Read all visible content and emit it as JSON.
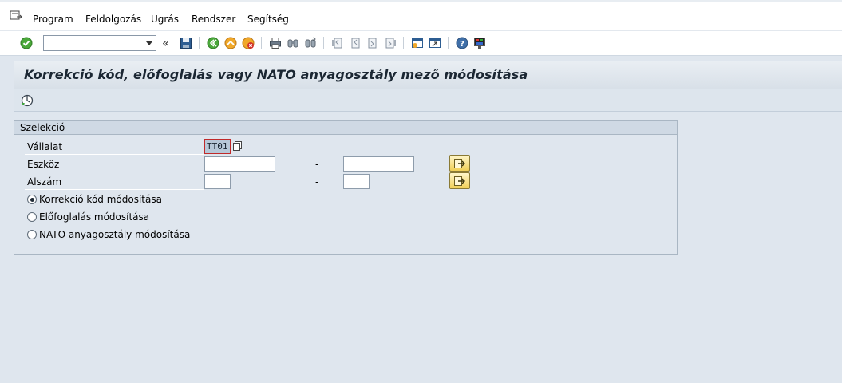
{
  "menu": {
    "items": [
      {
        "label": "Program"
      },
      {
        "label": "Feldolgozás"
      },
      {
        "label": "Ugrás"
      },
      {
        "label": "Rendszer"
      },
      {
        "label": "Segítség"
      }
    ]
  },
  "toolbar": {
    "command_value": "",
    "icons": [
      "enter-icon",
      "save-icon",
      "back-icon",
      "exit-icon",
      "cancel-icon",
      "print-icon",
      "find-icon",
      "find-next-icon",
      "first-page-icon",
      "previous-page-icon",
      "next-page-icon",
      "last-page-icon",
      "create-session-icon",
      "shortcut-icon",
      "help-icon",
      "customize-layout-icon"
    ]
  },
  "title": "Korrekció kód, előfoglalás vagy NATO anyagosztály mező módosítása",
  "group": {
    "title": "Szelekció",
    "fields": {
      "company": {
        "label": "Vállalat",
        "value": "TT01"
      },
      "asset": {
        "label": "Eszköz",
        "from": "",
        "to": "",
        "dash": "-"
      },
      "subnumber": {
        "label": "Alszám",
        "from": "",
        "to": "",
        "dash": "-"
      }
    },
    "radios": [
      {
        "label": "Korrekció kód módosítása",
        "selected": true
      },
      {
        "label": "Előfoglalás módosítása",
        "selected": false
      },
      {
        "label": "NATO anyagosztály módosítása",
        "selected": false
      }
    ]
  },
  "colors": {
    "background": "#dfe6ee",
    "title_text": "#1b2733",
    "required_border": "#c02a2a",
    "multisel_fill": "#f0cf56"
  }
}
